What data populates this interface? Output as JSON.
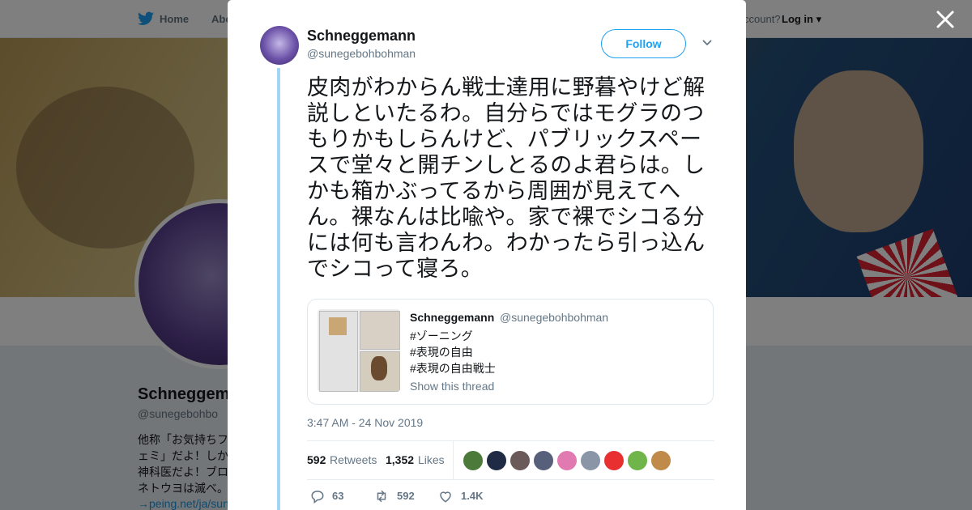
{
  "nav": {
    "home": "Home",
    "about": "Abo",
    "account_prompt": "ccount?",
    "login": "Log in"
  },
  "profile": {
    "name": "Schneggem",
    "handle": "@sunegebohbo",
    "bio": "他称「お気持ちフ\nェミ」だよ！しか\n神科医だよ！ブロ\nネトウヨは滅べ。",
    "link": "→peing.net/ja/sun"
  },
  "tweet": {
    "author_name": "Schneggemann",
    "author_handle": "@sunegebohbohman",
    "follow_label": "Follow",
    "text": "皮肉がわからん戦士達用に野暮やけど解説しといたるわ。自分らではモグラのつもりかもしらんけど、パブリックスペースで堂々と開チンしとるのよ君らは。しかも箱かぶってるから周囲が見えてへん。裸なんは比喩や。家で裸でシコる分には何も言わんわ。わかったら引っ込んでシコって寝ろ。",
    "timestamp": "3:47 AM - 24 Nov 2019",
    "retweets": "592",
    "retweets_label": "Retweets",
    "likes": "1,352",
    "likes_label": "Likes",
    "reply_count": "63",
    "retweet_count": "592",
    "like_count": "1.4K"
  },
  "quoted": {
    "name": "Schneggemann",
    "handle": "@sunegebohbohman",
    "lines": [
      "#ゾーニング",
      "#表現の自由",
      "#表現の自由戦士"
    ],
    "show_thread": "Show this thread"
  },
  "colors": {
    "accent": "#1da1f2",
    "thread_line": "#a3d5f5"
  },
  "icons": [
    "twitter-bird-icon",
    "close-icon",
    "chevron-down-icon",
    "reply-icon",
    "retweet-icon",
    "like-icon"
  ]
}
